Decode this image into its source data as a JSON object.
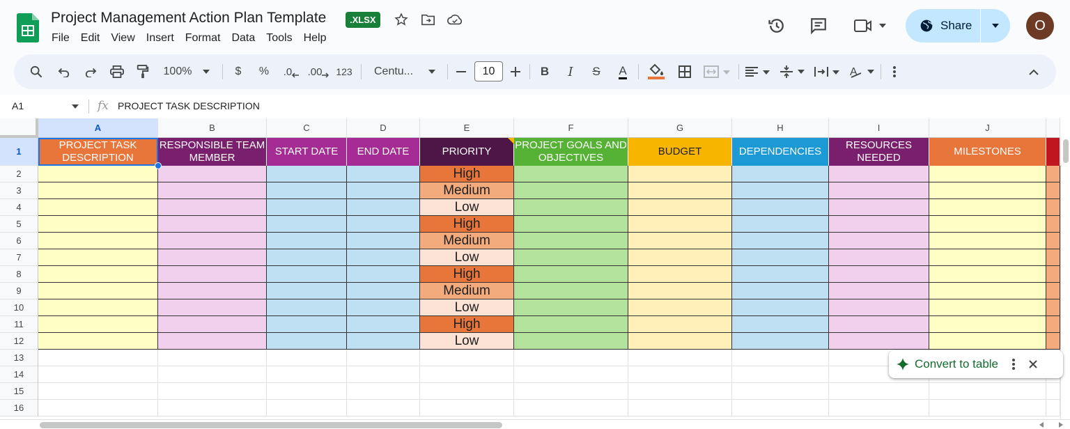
{
  "app": {
    "title": "Project Management Action Plan Template",
    "badge": ".XLSX",
    "menu": [
      "File",
      "Edit",
      "View",
      "Insert",
      "Format",
      "Data",
      "Tools",
      "Help"
    ],
    "share_label": "Share",
    "avatar_initial": "O"
  },
  "toolbar": {
    "zoom": "100%",
    "currency": "$",
    "percent": "%",
    "decrease_decimal": ".0",
    "increase_decimal": ".00",
    "number_format": "123",
    "font": "Centu...",
    "font_size": "10",
    "bold": "B",
    "italic": "I",
    "strike": "S",
    "text_color": "A"
  },
  "formula_bar": {
    "cell_ref": "A1",
    "fx": "fx",
    "content": "PROJECT TASK DESCRIPTION"
  },
  "columns": [
    "A",
    "B",
    "C",
    "D",
    "E",
    "F",
    "G",
    "H",
    "I",
    "J"
  ],
  "rows": [
    "1",
    "2",
    "3",
    "4",
    "5",
    "6",
    "7",
    "8",
    "9",
    "10",
    "11",
    "12",
    "13",
    "14",
    "15",
    "16"
  ],
  "headers": [
    {
      "label": "PROJECT TASK DESCRIPTION",
      "color": "#e8763a",
      "fill": "#ffffc5"
    },
    {
      "label": "RESPONSIBLE TEAM MEMBER",
      "color": "#7a1f6e",
      "fill": "#f1d0ee"
    },
    {
      "label": "START DATE",
      "color": "#a52c95",
      "fill": "#bfe0f3"
    },
    {
      "label": "END DATE",
      "color": "#a52c95",
      "fill": "#bfe0f3"
    },
    {
      "label": "PRIORITY",
      "color": "#4e1646",
      "fill": "#ffffff"
    },
    {
      "label": "PROJECT GOALS AND OBJECTIVES",
      "color": "#56b234",
      "fill": "#b2e29b"
    },
    {
      "label": "BUDGET",
      "color": "#f7b500",
      "fill": "#ffefb8"
    },
    {
      "label": "DEPENDENCIES",
      "color": "#1c9ad6",
      "fill": "#bfe0f3"
    },
    {
      "label": "RESOURCES NEEDED",
      "color": "#7a1f6e",
      "fill": "#f1d0ee"
    },
    {
      "label": "MILESTONES",
      "color": "#e8763a",
      "fill": "#ffffc5"
    }
  ],
  "priority": [
    "High",
    "Medium",
    "Low",
    "High",
    "Medium",
    "Low",
    "High",
    "Medium",
    "Low",
    "High",
    "Low"
  ],
  "priority_colors": {
    "High": "#e8763a",
    "Medium": "#f3ab7d",
    "Low": "#fce3d5"
  },
  "convert_label": "Convert to table"
}
